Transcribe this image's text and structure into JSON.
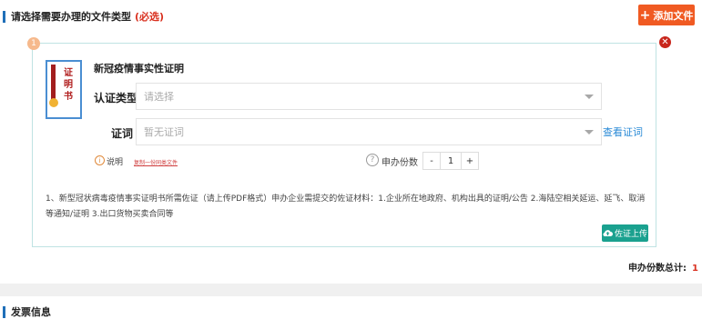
{
  "file_section": {
    "title": "请选择需要办理的文件类型",
    "required": "(必选)",
    "add_button": {
      "icon": "plus-icon",
      "label": "添加文件"
    }
  },
  "card": {
    "index": "1",
    "close_icon": "close-icon",
    "cert_icon_text": [
      "证",
      "明",
      "书"
    ],
    "doc_title": "新冠疫情事实性证明",
    "cert_type": {
      "label": "认证类型",
      "placeholder": "请选择"
    },
    "certificate_word": {
      "label": "证词",
      "placeholder": "暂无证词",
      "view_link": "查看证词"
    },
    "note": {
      "icon": "info-icon",
      "label": "说明",
      "link": "复制一份同类文件"
    },
    "copies": {
      "icon": "help-icon",
      "label": "申办份数",
      "minus": "-",
      "value": "1",
      "plus": "+"
    },
    "description": "1、新型冠状病毒疫情事实证明书所需佐证（请上传PDF格式）申办企业需提交的佐证材料：1.企业所在地政府、机构出具的证明/公告 2.海陆空相关延运、延飞、取消等通知/证明 3.出口货物买卖合同等",
    "upload_button": {
      "icon": "cloud-upload-icon",
      "label": "佐证上传"
    }
  },
  "total": {
    "label": "申办份数总计:",
    "value": "1"
  },
  "invoice_section": {
    "title": "发票信息"
  },
  "colors": {
    "accent": "#1f6fb8",
    "orange": "#f05a22",
    "red": "#d9301f",
    "teal": "#1aa18f",
    "link": "#2a8ad6"
  }
}
